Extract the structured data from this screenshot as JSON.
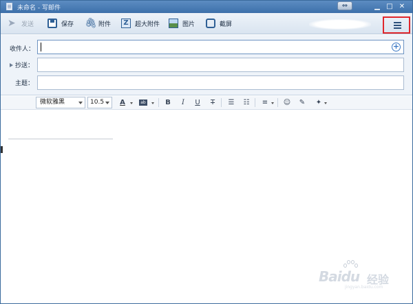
{
  "window": {
    "title": "未命名 - 写邮件",
    "restore_icon": "restore-arrows-icon",
    "controls": [
      "minimize-icon",
      "maximize-icon",
      "close-icon"
    ]
  },
  "toolbar": {
    "send_label": "发送",
    "save_label": "保存",
    "attach_label": "附件",
    "big_attach_label": "超大附件",
    "image_label": "图片",
    "screenshot_label": "截屏",
    "menu_icon": "list-menu-icon",
    "highlight_color": "#e0262b"
  },
  "header": {
    "to_label": "收件人：",
    "cc_label": "抄送：",
    "subject_label": "主题：",
    "to_value": "",
    "cc_value": "",
    "subject_value": ""
  },
  "format": {
    "font": "微软雅黑",
    "size": "10.5",
    "color_glyph": "A",
    "bold_glyph": "B",
    "italic_glyph": "I",
    "underline_glyph": "U",
    "strike_glyph": "T"
  },
  "watermark": {
    "brand": "Baidu",
    "suffix": "经验",
    "url": "jingyan.baidu.com"
  },
  "colors": {
    "titlebar": "#3d70aa",
    "toolbar": "#d9e4f0",
    "panel": "#eef3f9"
  }
}
